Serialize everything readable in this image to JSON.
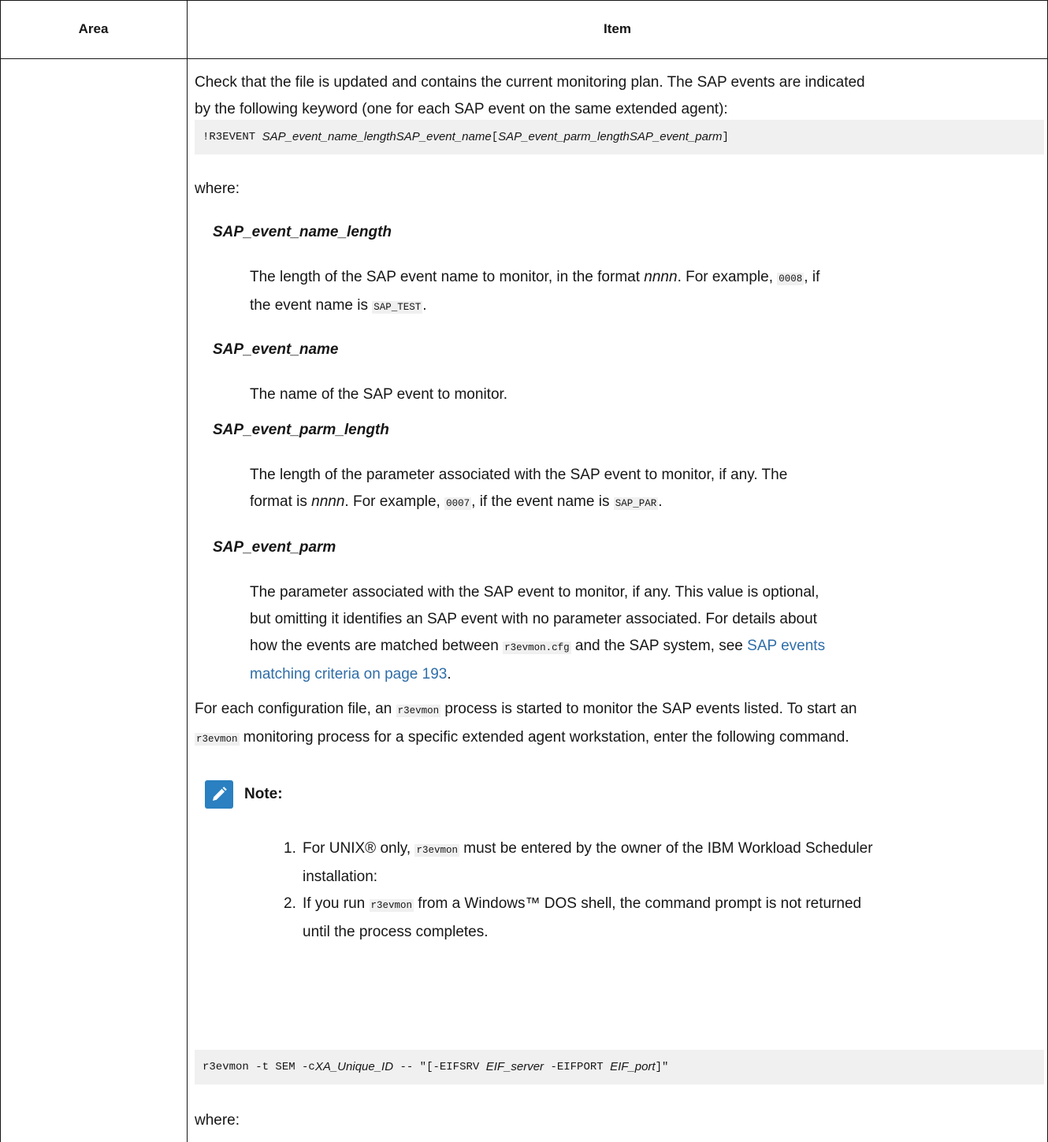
{
  "header": {
    "area": "Area",
    "item": "Item"
  },
  "intro": {
    "line1": "Check that the file is updated and contains the current monitoring plan. The SAP events are indicated",
    "line2": "by the following keyword (one for each SAP event on the same extended agent):"
  },
  "code1": {
    "keyword": "!R3EVENT",
    "name_length": "SAP_event_name_length",
    "name": "SAP_event_name",
    "open": "[",
    "parm_length": "SAP_event_parm_length",
    "parm": "SAP_event_parm",
    "close": "]"
  },
  "where1": "where:",
  "terms": [
    {
      "term": "SAP_event_name_length"
    },
    {
      "term": "SAP_event_name"
    },
    {
      "term": "SAP_event_parm_length"
    },
    {
      "term": "SAP_event_parm"
    }
  ],
  "defs": {
    "d1_a": "The length of the SAP event name to monitor, in the format ",
    "d1_nnnn": "nnnn",
    "d1_b": ". For example, ",
    "d1_code1": "0008",
    "d1_c": ", if",
    "d1_d": "the event name is ",
    "d1_code2": "SAP_TEST",
    "d1_e": ".",
    "d2": "The name of the SAP event to monitor.",
    "d3_a": "The length of the parameter associated with the SAP event to monitor, if any. The",
    "d3_b": "format is ",
    "d3_nnnn": "nnnn",
    "d3_c": ". For example, ",
    "d3_code1": "0007",
    "d3_d": ", if the event name is ",
    "d3_code2": "SAP_PAR",
    "d3_e": ".",
    "d4_l1": "The parameter associated with the SAP event to monitor, if any. This value is optional,",
    "d4_l2": "but omitting it identifies an SAP event with no parameter associated. For details about",
    "d4_l3a": "how the events are matched between ",
    "d4_code": "r3evmon.cfg",
    "d4_l3b": " and the SAP system, see ",
    "d4_link1": "SAP events",
    "d4_link2": "matching criteria on page 193",
    "d4_end": "."
  },
  "para2": {
    "a": "For each configuration file, an ",
    "code1": "r3evmon",
    "b": " process is started to monitor the SAP events listed. To start an",
    "code2": "r3evmon",
    "c": " monitoring process for a specific extended agent workstation, enter the following command."
  },
  "note": {
    "title": "Note:",
    "items": [
      {
        "num": "1.",
        "a": "For UNIX® only, ",
        "code": "r3evmon",
        "b": " must be entered by the owner of the IBM Workload Scheduler",
        "c": "installation:"
      },
      {
        "num": "2.",
        "a": "If you run ",
        "code": "r3evmon",
        "b": " from a Windows™ DOS shell, the command prompt is not returned",
        "c": "until the process completes."
      }
    ]
  },
  "code2": {
    "a": "r3evmon -t SEM -c ",
    "id": "XA_Unique_ID",
    "b": " -- \"[-EIFSRV ",
    "srv": "EIF_server",
    "c": " -EIFPORT ",
    "port": "EIF_port",
    "d": "]\""
  },
  "where2": "where:"
}
